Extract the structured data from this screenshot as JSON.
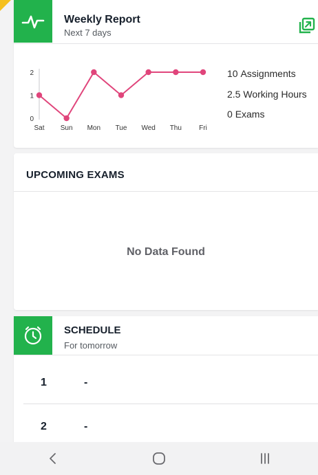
{
  "colors": {
    "accent_green": "#22b24c",
    "chart_line": "#e0457b",
    "background": "#f3f3f4",
    "corner_flag": "#f5c01e"
  },
  "weekly_report": {
    "icon": "activity-pulse-icon",
    "title": "Weekly Report",
    "subtitle": "Next 7 days",
    "expand_icon": "open-external-icon",
    "stats": [
      {
        "value": "10",
        "label": "Assignments"
      },
      {
        "value": "2.5",
        "label": "Working Hours"
      },
      {
        "value": "0",
        "label": "Exams"
      }
    ]
  },
  "chart_data": {
    "type": "line",
    "categories": [
      "Sat",
      "Sun",
      "Mon",
      "Tue",
      "Wed",
      "Thu",
      "Fri"
    ],
    "values": [
      1,
      0,
      2,
      1,
      2,
      2,
      2
    ],
    "y_ticks": [
      "0",
      "1",
      "2"
    ],
    "ylim": [
      0,
      2
    ],
    "grid": false,
    "color": "#e0457b"
  },
  "upcoming_exams": {
    "title": "UPCOMING EXAMS",
    "empty_text": "No Data Found"
  },
  "schedule": {
    "icon": "clock-icon",
    "title": "SCHEDULE",
    "subtitle": "For tomorrow",
    "rows": [
      {
        "number": "1",
        "value": "-"
      },
      {
        "number": "2",
        "value": "-"
      }
    ]
  },
  "navbar": {
    "back_icon": "back-chevron-icon",
    "home_icon": "home-circle-icon",
    "recents_icon": "recent-apps-icon"
  }
}
